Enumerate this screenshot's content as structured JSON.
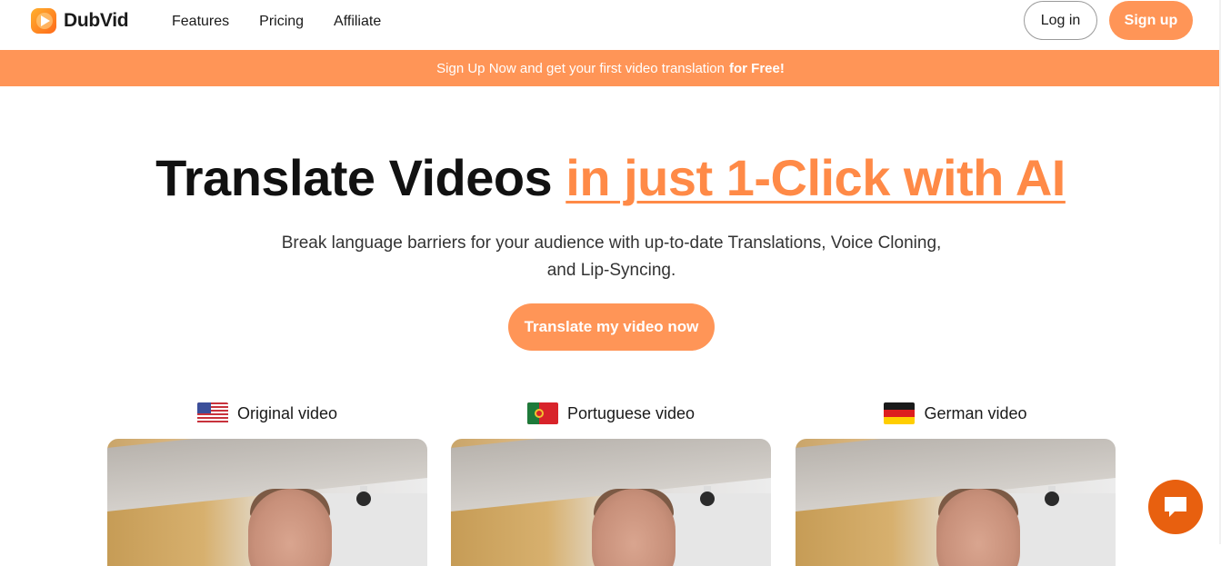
{
  "brand": {
    "name": "DubVid"
  },
  "nav": {
    "links": [
      "Features",
      "Pricing",
      "Affiliate"
    ],
    "login_label": "Log in",
    "signup_label": "Sign up"
  },
  "banner": {
    "text": "Sign Up Now and get your first video translation",
    "bold": "for Free!"
  },
  "hero": {
    "title_main": "Translate Videos",
    "title_accent": "in just 1-Click with AI",
    "subtitle_line1": "Break language barriers for your audience with up-to-date Translations, Voice Cloning,",
    "subtitle_line2": "and Lip-Syncing.",
    "cta_label": "Translate my video now"
  },
  "videos": [
    {
      "label": "Original video",
      "flag": "us-flag-icon"
    },
    {
      "label": "Portuguese video",
      "flag": "portugal-flag-icon"
    },
    {
      "label": "German video",
      "flag": "germany-flag-icon"
    }
  ],
  "colors": {
    "accent": "#ff9557",
    "accent_text": "#ff8a47",
    "chat": "#e8600f"
  }
}
